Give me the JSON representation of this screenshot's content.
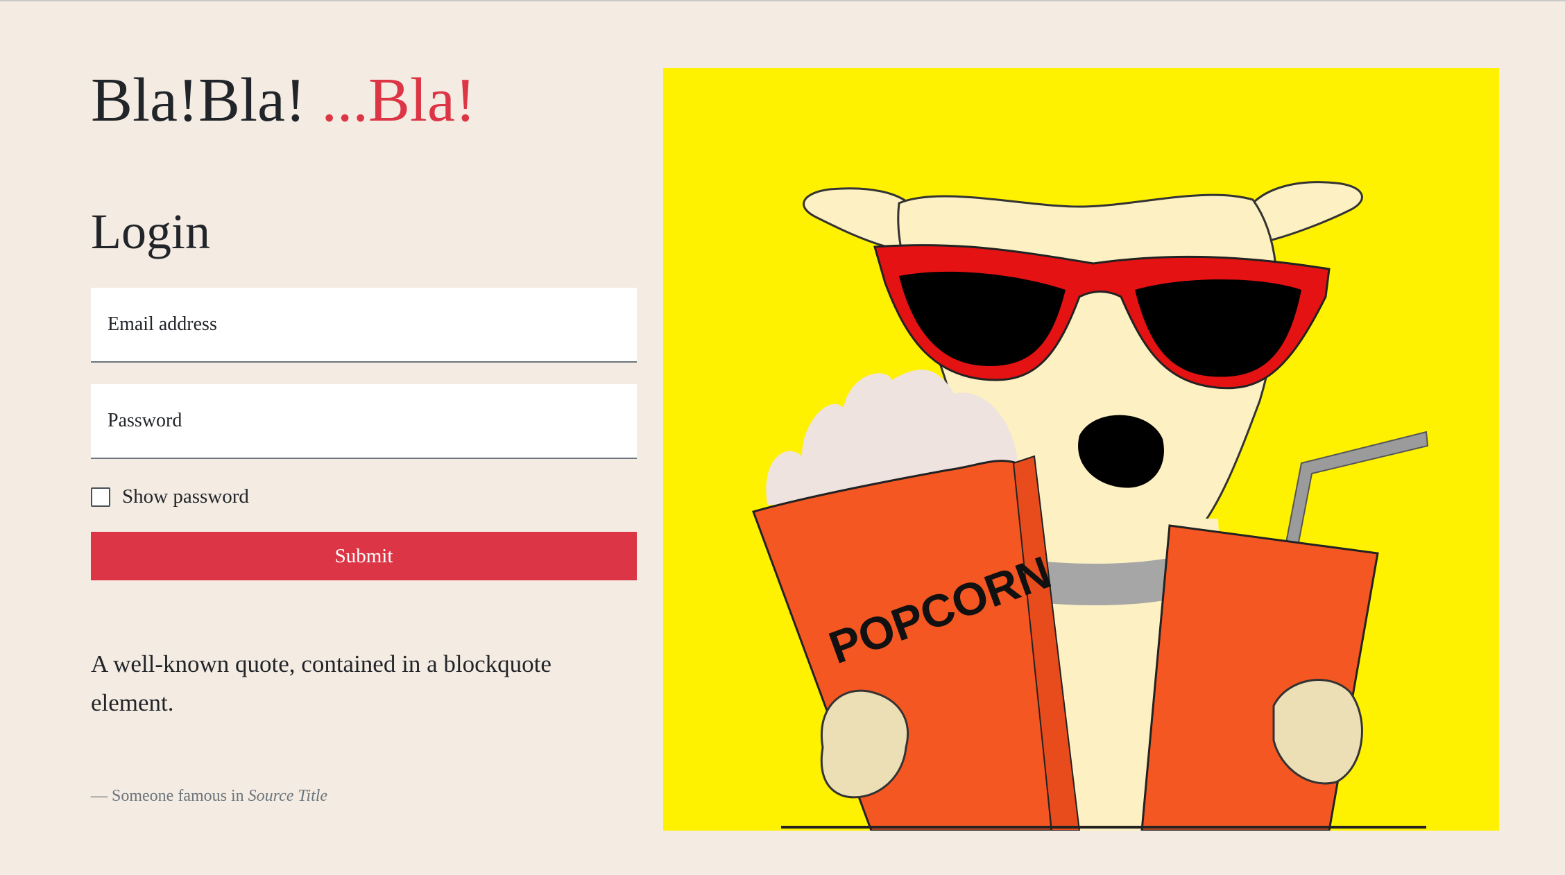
{
  "brand": {
    "part1": "Bla!Bla! ",
    "part2": "...Bla!"
  },
  "login": {
    "title": "Login",
    "email_placeholder": "Email address",
    "password_placeholder": "Password",
    "show_password_label": "Show password",
    "submit_label": "Submit"
  },
  "quote": {
    "text": "A well-known quote, contained in a blockquote element.",
    "cite_prefix": "— Someone famous in ",
    "cite_source": "Source Title"
  },
  "hero": {
    "popcorn_label": "POPCORN"
  },
  "colors": {
    "accent": "#dc3545",
    "background": "#f4ebe2",
    "hero_bg": "#fff200"
  }
}
